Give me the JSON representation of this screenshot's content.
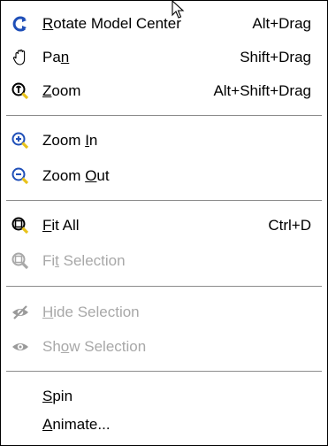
{
  "menu": {
    "items": [
      {
        "label_pre": "",
        "label_mn": "R",
        "label_post": "otate Model Center",
        "shortcut": "Alt+Drag",
        "icon": "rotate-icon",
        "enabled": true
      },
      {
        "label_pre": "Pa",
        "label_mn": "n",
        "label_post": "",
        "shortcut": "Shift+Drag",
        "icon": "hand-pan-icon",
        "enabled": true
      },
      {
        "label_pre": "",
        "label_mn": "Z",
        "label_post": "oom",
        "shortcut": "Alt+Shift+Drag",
        "icon": "zoom-icon",
        "enabled": true
      },
      {
        "label_pre": "Zoom ",
        "label_mn": "I",
        "label_post": "n",
        "shortcut": "",
        "icon": "zoom-in-icon",
        "enabled": true
      },
      {
        "label_pre": "Zoom ",
        "label_mn": "O",
        "label_post": "ut",
        "shortcut": "",
        "icon": "zoom-out-icon",
        "enabled": true
      },
      {
        "label_pre": "",
        "label_mn": "F",
        "label_post": "it All",
        "shortcut": "Ctrl+D",
        "icon": "fit-all-icon",
        "enabled": true
      },
      {
        "label_pre": "Fi",
        "label_mn": "t",
        "label_post": " Selection",
        "shortcut": "",
        "icon": "fit-selection-icon",
        "enabled": false
      },
      {
        "label_pre": "",
        "label_mn": "H",
        "label_post": "ide Selection",
        "shortcut": "",
        "icon": "hide-selection-icon",
        "enabled": false
      },
      {
        "label_pre": "Sh",
        "label_mn": "o",
        "label_post": "w Selection",
        "shortcut": "",
        "icon": "show-selection-icon",
        "enabled": false
      },
      {
        "label_pre": "",
        "label_mn": "S",
        "label_post": "pin",
        "shortcut": "",
        "icon": "",
        "enabled": true
      },
      {
        "label_pre": "",
        "label_mn": "A",
        "label_post": "nimate...",
        "shortcut": "",
        "icon": "",
        "enabled": true
      }
    ]
  },
  "colors": {
    "text": "#000000",
    "disabled_text": "#a8a8a8",
    "icon_blue": "#1f4fb8",
    "icon_yellow": "#e8c21a",
    "separator": "#8c8c8c"
  }
}
